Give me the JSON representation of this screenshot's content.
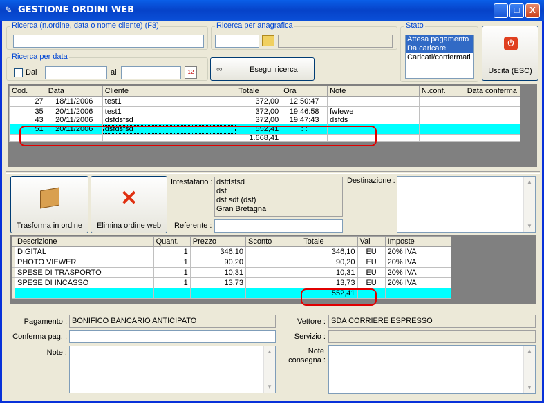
{
  "window": {
    "title": "GESTIONE ORDINI WEB",
    "min": "_",
    "max": "□",
    "close": "X"
  },
  "search": {
    "main_label": "Ricerca (n.ordine, data o nome cliente) (F3)",
    "main_value": "",
    "anag_label": "Ricerca per anagrafica",
    "date_label": "Ricerca per data",
    "dal_label": "Dal",
    "al_label": "al",
    "search_button": "Esegui ricerca",
    "calendar_text": "12"
  },
  "stato": {
    "label": "Stato",
    "options": [
      "Attesa pagamento",
      "Da caricare",
      "Caricati/confermati"
    ]
  },
  "exit_button": "Uscita (ESC)",
  "orders": {
    "headers": [
      "Cod.",
      "Data",
      "Cliente",
      "Totale",
      "Ora",
      "Note",
      "N.conf.",
      "Data conferma"
    ],
    "rows": [
      [
        "27",
        "18/11/2006",
        "test1",
        "372,00",
        "12:50:47",
        "",
        "",
        ""
      ],
      [
        "35",
        "20/11/2006",
        "test1",
        "372,00",
        "19:46:58",
        "fwfewe",
        "",
        ""
      ],
      [
        "43",
        "20/11/2006",
        "dsfdsfsd",
        "372,00",
        "19:47:43",
        "dsfds",
        "",
        ""
      ],
      [
        "51",
        "20/11/2006",
        "dsfdsfsd",
        "552,41",
        " :  :",
        "",
        "",
        ""
      ]
    ],
    "total": "1.668,41"
  },
  "actions": {
    "transform": "Trasforma in ordine",
    "delete": "Elimina ordine web"
  },
  "intestatario": {
    "label": "Intestatario :",
    "lines": [
      "dsfdsfsd",
      "dsf",
      "dsf sdf (dsf)",
      "Gran Bretagna"
    ],
    "referente_label": "Referente :",
    "referente_value": "",
    "destinazione_label": "Destinazione :"
  },
  "items": {
    "headers": [
      "Descrizione",
      "Quant.",
      "Prezzo",
      "Sconto",
      "Totale",
      "Val",
      "Imposte"
    ],
    "rows": [
      [
        "DIGITAL",
        "1",
        "346,10",
        "",
        "346,10",
        "EU",
        "20% IVA"
      ],
      [
        "PHOTO VIEWER",
        "1",
        "90,20",
        "",
        "90,20",
        "EU",
        "20% IVA"
      ],
      [
        "SPESE DI TRASPORTO",
        "1",
        "10,31",
        "",
        "10,31",
        "EU",
        "20% IVA"
      ],
      [
        "SPESE DI INCASSO",
        "1",
        "13,73",
        "",
        "13,73",
        "EU",
        "20% IVA"
      ]
    ],
    "total": "552,41"
  },
  "footer": {
    "pagamento_label": "Pagamento :",
    "pagamento_value": "BONIFICO BANCARIO ANTICIPATO",
    "conferma_label": "Conferma pag. :",
    "note_label": "Note :",
    "vettore_label": "Vettore :",
    "vettore_value": "SDA CORRIERE ESPRESSO",
    "servizio_label": "Servizio :",
    "note_consegna_label_1": "Note",
    "note_consegna_label_2": "consegna :"
  },
  "colors": {
    "selection": "#00ffff",
    "highlight": "#e00000",
    "titlebar": "#0642c8"
  }
}
